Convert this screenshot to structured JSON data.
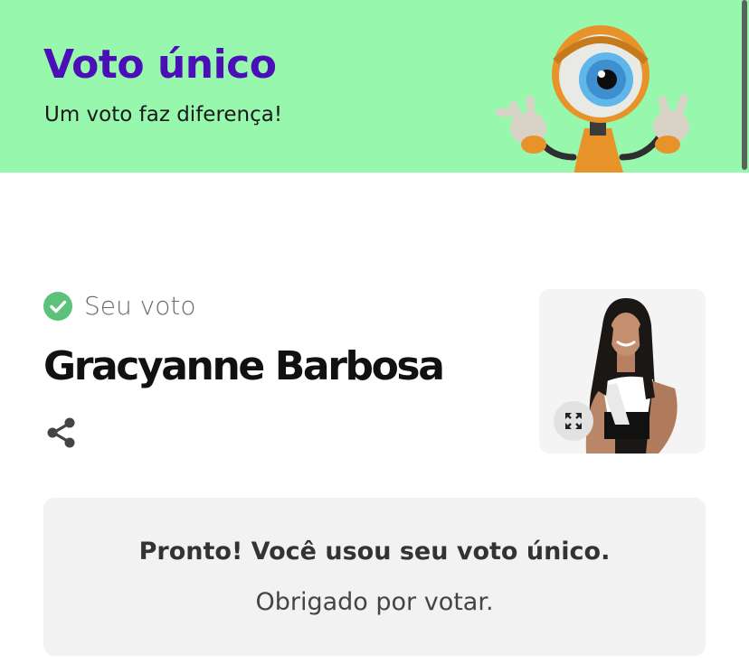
{
  "header": {
    "title": "Voto único",
    "subtitle": "Um voto faz diferença!",
    "background_color": "#97f7ad",
    "title_color": "#4b0fb7",
    "mascot_icon": "big-brother-eye-mascot"
  },
  "vote": {
    "label": "Seu voto",
    "status_icon": "check-circle-icon",
    "status_color": "#5cc27a",
    "candidate_name": "Gracyanne Barbosa",
    "share_icon": "share-icon",
    "photo_icon": "candidate-photo",
    "expand_icon": "expand-icon"
  },
  "confirmation": {
    "title": "Pronto! Você usou seu voto único.",
    "message": "Obrigado por votar."
  }
}
